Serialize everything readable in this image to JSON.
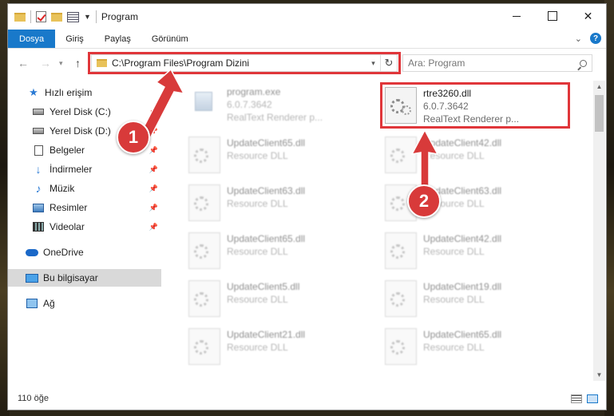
{
  "window": {
    "title": "Program"
  },
  "ribbon": {
    "tabs": [
      "Dosya",
      "Giriş",
      "Paylaş",
      "Görünüm"
    ]
  },
  "address": {
    "path": "C:\\Program Files\\Program Dizini"
  },
  "search": {
    "placeholder": "Ara: Program"
  },
  "sidebar": {
    "items": [
      {
        "label": "Hızlı erişim",
        "icon": "star-icon"
      },
      {
        "label": "Yerel Disk (C:)",
        "icon": "drive-icon"
      },
      {
        "label": "Yerel Disk (D:)",
        "icon": "drive-icon"
      },
      {
        "label": "Belgeler",
        "icon": "documents-icon"
      },
      {
        "label": "İndirmeler",
        "icon": "download-icon"
      },
      {
        "label": "Müzik",
        "icon": "music-icon"
      },
      {
        "label": "Resimler",
        "icon": "pictures-icon"
      },
      {
        "label": "Videolar",
        "icon": "video-icon"
      },
      {
        "label": "OneDrive",
        "icon": "cloud-icon"
      },
      {
        "label": "Bu bilgisayar",
        "icon": "computer-icon"
      },
      {
        "label": "Ağ",
        "icon": "network-icon"
      }
    ]
  },
  "files": [
    {
      "name": "program.exe",
      "version": "6.0.7.3642",
      "desc": "RealText Renderer p..."
    },
    {
      "name": "rtre3260.dll",
      "version": "6.0.7.3642",
      "desc": "RealText Renderer p..."
    },
    {
      "name": "UpdateClient65.dll",
      "desc": "Resource DLL"
    },
    {
      "name": "UpdateClient42.dll",
      "desc": "Resource DLL"
    },
    {
      "name": "UpdateClient63.dll",
      "desc": "Resource DLL"
    },
    {
      "name": "UpdateClient63.dll",
      "desc": "Resource DLL"
    },
    {
      "name": "UpdateClient65.dll",
      "desc": "Resource DLL"
    },
    {
      "name": "UpdateClient42.dll",
      "desc": "Resource DLL"
    },
    {
      "name": "UpdateClient5.dll",
      "desc": "Resource DLL"
    },
    {
      "name": "UpdateClient19.dll",
      "desc": "Resource DLL"
    },
    {
      "name": "UpdateClient21.dll",
      "desc": "Resource DLL"
    },
    {
      "name": "UpdateClient65.dll",
      "desc": "Resource DLL"
    }
  ],
  "status": {
    "count": "110 öğe"
  },
  "callouts": {
    "step1": "1",
    "step2": "2",
    "color": "#d83a3a"
  },
  "colors": {
    "accent": "#1979ca",
    "highlight": "#e0363a"
  }
}
